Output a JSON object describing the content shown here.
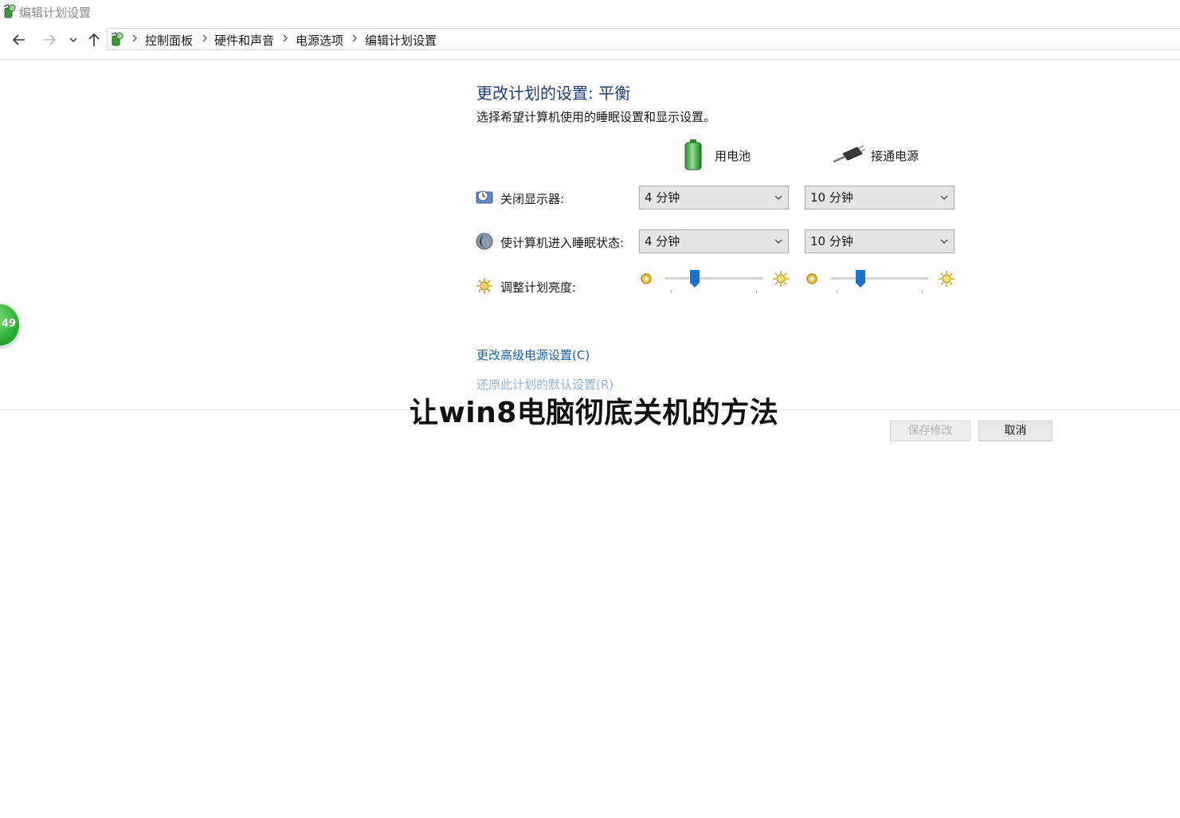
{
  "window": {
    "title": "编辑计划设置"
  },
  "breadcrumb": [
    "控制面板",
    "硬件和声音",
    "电源选项",
    "编辑计划设置"
  ],
  "main": {
    "heading": "更改计划的设置: 平衡",
    "subtitle": "选择希望计算机使用的睡眠设置和显示设置。",
    "columns": {
      "battery": "用电池",
      "plugged": "接通电源"
    },
    "rows": {
      "display_off": {
        "label": "关闭显示器:",
        "battery": "4 分钟",
        "plugged": "10 分钟"
      },
      "sleep": {
        "label": "使计算机进入睡眠状态:",
        "battery": "4 分钟",
        "plugged": "10 分钟"
      },
      "brightness": {
        "label": "调整计划亮度:",
        "battery_level": 0.28,
        "plugged_level": 0.28
      }
    },
    "links": {
      "advanced": "更改高级电源设置(C)",
      "restore": "还原此计划的默认设置(R)"
    }
  },
  "buttons": {
    "save": "保存修改",
    "cancel": "取消"
  },
  "badge": {
    "text": "49"
  },
  "overlay": {
    "title": "让win8电脑彻底关机的方法"
  },
  "colors": {
    "heading": "#1e3f79",
    "link": "#1e5fa8",
    "slider_thumb": "#1a73c9",
    "badge": "#2fae35"
  }
}
